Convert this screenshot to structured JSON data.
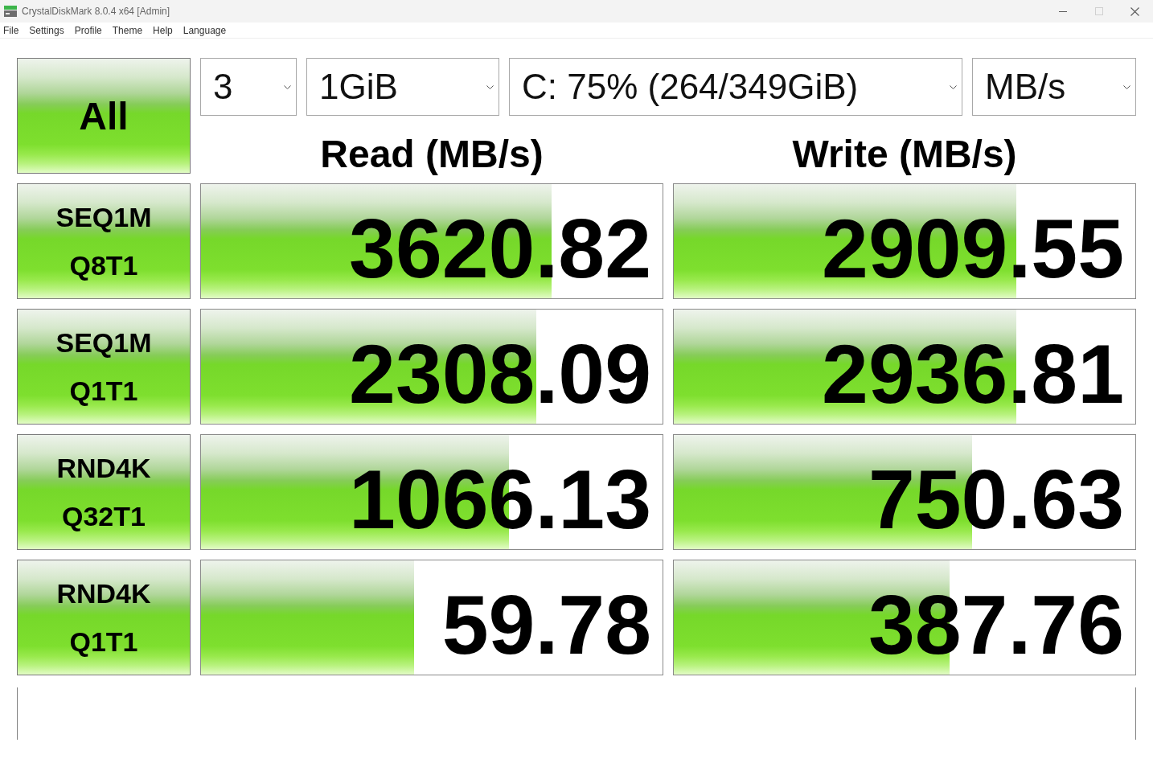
{
  "window": {
    "title": "CrystalDiskMark 8.0.4 x64 [Admin]",
    "controls": [
      {
        "kind": "minimize",
        "disabled": false
      },
      {
        "kind": "maximize",
        "disabled": true
      },
      {
        "kind": "close",
        "disabled": false
      }
    ]
  },
  "menu": [
    "File",
    "Settings",
    "Profile",
    "Theme",
    "Help",
    "Language"
  ],
  "all_button": "All",
  "selectors": [
    {
      "value": "3"
    },
    {
      "value": "1GiB"
    },
    {
      "value": "C: 75% (264/349GiB)"
    },
    {
      "value": "MB/s"
    }
  ],
  "headers": [
    "Read (MB/s)",
    "Write (MB/s)"
  ],
  "tests": [
    {
      "name": "SEQ1M",
      "params": "Q8T1",
      "read": {
        "value": "3620.82",
        "level": 0.76
      },
      "write": {
        "value": "2909.55",
        "level": 0.743
      }
    },
    {
      "name": "SEQ1M",
      "params": "Q1T1",
      "read": {
        "value": "2308.09",
        "level": 0.726
      },
      "write": {
        "value": "2936.81",
        "level": 0.743
      }
    },
    {
      "name": "RND4K",
      "params": "Q32T1",
      "read": {
        "value": "1066.13",
        "level": 0.668
      },
      "write": {
        "value": "750.63",
        "level": 0.646
      }
    },
    {
      "name": "RND4K",
      "params": "Q1T1",
      "read": {
        "value": "59.78",
        "level": 0.462
      },
      "write": {
        "value": "387.76",
        "level": 0.597
      }
    }
  ]
}
